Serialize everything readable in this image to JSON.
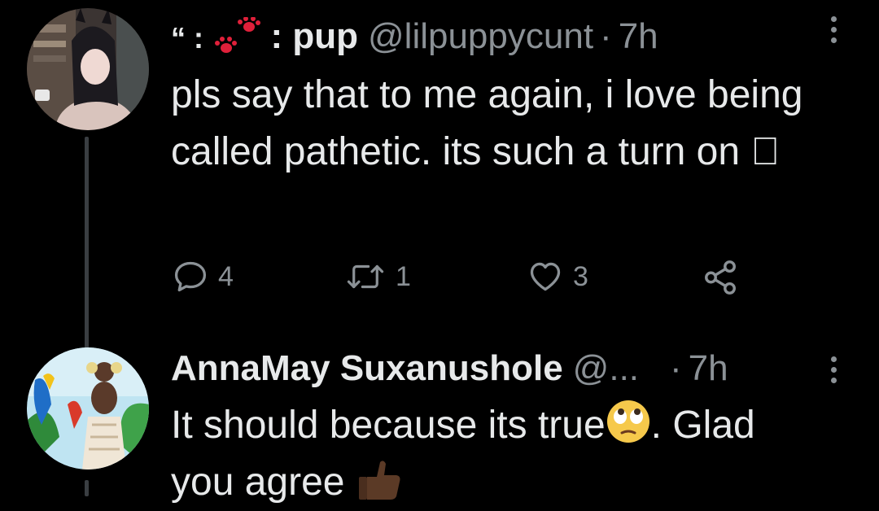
{
  "tweets": [
    {
      "display_name_prefix": "“ :",
      "display_name_mid": ":",
      "display_name": "pup",
      "handle": "@lilpuppycunt",
      "separator": "·",
      "time": "7h",
      "text": "pls say that to me again, i love being called pathetic. its such a turn on \u0000",
      "actions": {
        "reply_count": "4",
        "retweet_count": "1",
        "like_count": "3"
      }
    },
    {
      "display_name": "AnnaMay Suxanushole",
      "handle": "@...",
      "separator": "·",
      "time": "7h",
      "text_part1": "It should because its true",
      "text_part2": ". Glad you agree"
    }
  ],
  "icons": {
    "reply": "reply-icon",
    "retweet": "retweet-icon",
    "like": "heart-icon",
    "share": "share-icon",
    "more": "more-vertical-icon",
    "paw": "paw-prints-icon",
    "eye_roll": "eye-roll-emoji-icon",
    "thumbs_up": "thumbs-up-emoji-icon"
  },
  "colors": {
    "background": "#000000",
    "primary_text": "#e7e9ea",
    "secondary_text": "#8b9196",
    "paw_red": "#e0203a"
  }
}
